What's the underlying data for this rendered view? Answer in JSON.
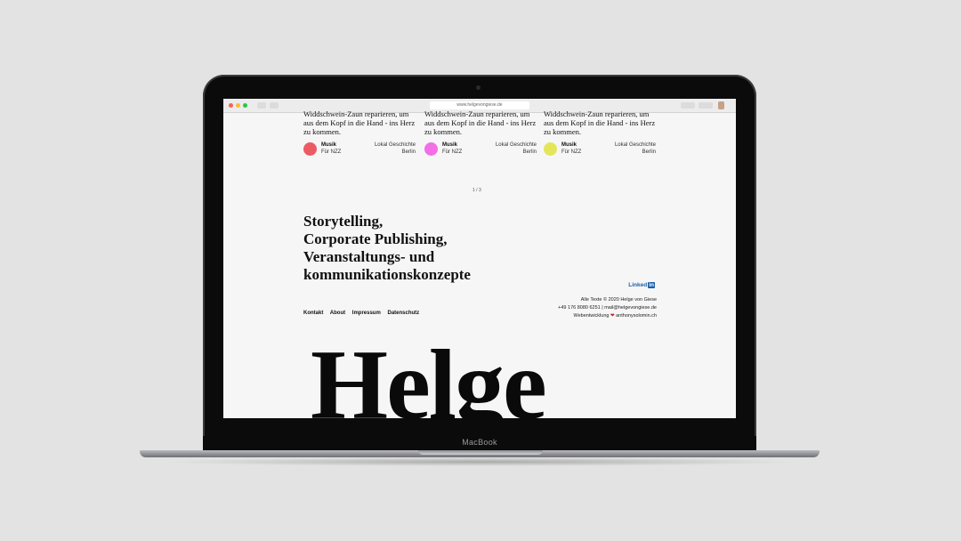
{
  "device": {
    "brand_label": "MacBook"
  },
  "browser": {
    "url": "www.helgevongiese.de"
  },
  "cards": [
    {
      "text": "Widdschwein-Zaun reparieren, um aus dem Kopf in die Hand - ins Herz zu kommen.",
      "category": "Musik",
      "subcategory": "Für NZZ",
      "right_line1": "Lokal Geschichte",
      "right_line2": "Berlin",
      "color": "#ec5b63"
    },
    {
      "text": "Widdschwein-Zaun reparieren, um aus dem Kopf in die Hand - ins Herz zu kommen.",
      "category": "Musik",
      "subcategory": "Für NZZ",
      "right_line1": "Lokal Geschichte",
      "right_line2": "Berlin",
      "color": "#f26fe6"
    },
    {
      "text": "Widdschwein-Zaun reparieren, um aus dem Kopf in die Hand - ins Herz zu kommen.",
      "category": "Musik",
      "subcategory": "Für NZZ",
      "right_line1": "Lokal Geschichte",
      "right_line2": "Berlin",
      "color": "#e4e65a"
    }
  ],
  "pager": "1 / 3",
  "headline": [
    "Storytelling,",
    "Corporate Publishing,",
    "Veranstaltungs- und",
    "kommunikationskonzepte"
  ],
  "nav": [
    "Kontakt",
    "About",
    "Impressum",
    "Datenschutz"
  ],
  "linkedin": {
    "label": "Linked",
    "badge": "in"
  },
  "footer": {
    "copyright": "Alle Texte © 2020 Helge von Giese",
    "contact": "+49 176 8080 6251 | mail@helgevongiese.de",
    "credit_prefix": "Webentwicklung",
    "credit_suffix": "anthonysolomin.ch"
  },
  "bigword": "Helge"
}
